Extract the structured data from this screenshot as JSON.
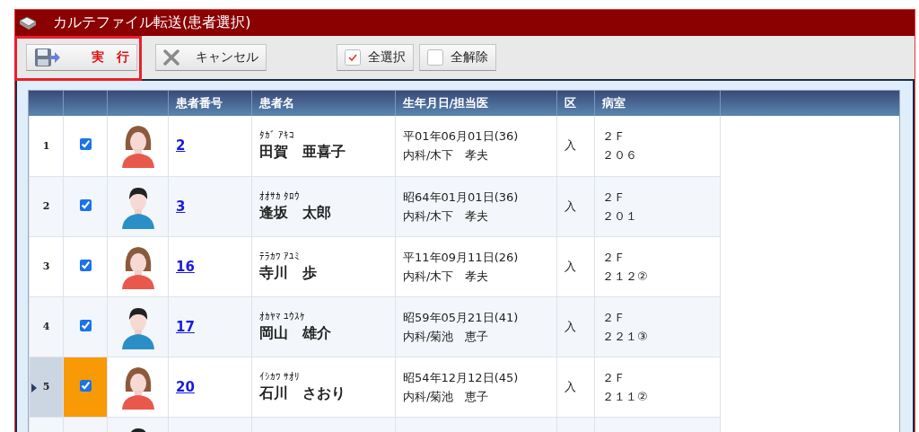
{
  "window": {
    "title": "カルテファイル転送(患者選択)"
  },
  "toolbar": [
    {
      "label": "実　行",
      "kind": "save",
      "highlighted": true
    },
    {
      "label": "キャンセル",
      "kind": "cancel",
      "highlighted": false
    },
    {
      "label": "全選択",
      "kind": "select-all",
      "highlighted": false
    },
    {
      "label": "全解除",
      "kind": "clear-all",
      "highlighted": false
    }
  ],
  "table": {
    "columns": [
      "患者番号",
      "患者名",
      "生年月日/担当医",
      "区",
      "病室"
    ],
    "rows": [
      {
        "row_number": "1",
        "checked": true,
        "selected": false,
        "kind": "female",
        "patient_no": "2",
        "kana": "ﾀｶﾞ ｱｷｺ",
        "name": "田賀　亜喜子",
        "birth": "平01年06月01日(36)",
        "doctor": "内科/木下　孝夫",
        "ward_type": "入",
        "floor": "２Ｆ",
        "room": "２０６"
      },
      {
        "row_number": "2",
        "checked": true,
        "selected": false,
        "kind": "male",
        "patient_no": "3",
        "kana": "ｵｵｻｶ ﾀﾛｳ",
        "name": "逢坂　太郎",
        "birth": "昭64年01月01日(36)",
        "doctor": "内科/木下　孝夫",
        "ward_type": "入",
        "floor": "２Ｆ",
        "room": "２０１"
      },
      {
        "row_number": "3",
        "checked": true,
        "selected": false,
        "kind": "female",
        "patient_no": "16",
        "kana": "ﾃﾗｶﾜ ｱﾕﾐ",
        "name": "寺川　歩",
        "birth": "平11年09月11日(26)",
        "doctor": "内科/木下　孝夫",
        "ward_type": "入",
        "floor": "２Ｆ",
        "room": "２１２②"
      },
      {
        "row_number": "4",
        "checked": true,
        "selected": false,
        "kind": "male",
        "patient_no": "17",
        "kana": "ｵｶﾔﾏ ﾕｳｽｹ",
        "name": "岡山　雄介",
        "birth": "昭59年05月21日(41)",
        "doctor": "内科/菊池　恵子",
        "ward_type": "入",
        "floor": "２Ｆ",
        "room": "２２１③"
      },
      {
        "row_number": "5",
        "checked": true,
        "selected": true,
        "kind": "female",
        "patient_no": "20",
        "kana": "ｲｼｶﾜ ｻｵﾘ",
        "name": "石川　さおり",
        "birth": "昭54年12月12日(45)",
        "doctor": "内科/菊池　恵子",
        "ward_type": "入",
        "floor": "２Ｆ",
        "room": "２１１②"
      },
      {
        "kind": "male"
      }
    ]
  }
}
